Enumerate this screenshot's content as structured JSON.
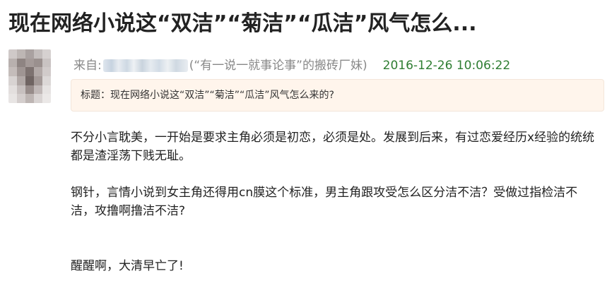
{
  "post": {
    "title": "现在网络小说这“双洁”“菊洁”“瓜洁”风气怎么...",
    "meta": {
      "from_label": "来自:",
      "author_desc": "(“有一说一就事论事”的搬砖厂妹)",
      "timestamp": "2016-12-26 10:06:22"
    },
    "subject": "标题：现在网络小说这“双洁”“菊洁”“瓜洁”风气怎么来的?",
    "body": [
      "不分小言耽美，一开始是要求主角必须是初恋，必须是处。发展到后来，有过恋爱经历x经验的统统都是渣淫荡下贱无耻。",
      "钢针，言情小说到女主角还得用cn膜这个标准，男主角跟攻受怎么区分洁不洁？受做过指检洁不洁，攻撸啊撸洁不洁?",
      "醒醒啊，大清早亡了!"
    ]
  },
  "colors": {
    "timestamp_green": "#2e7d32",
    "subject_background": "#fff5ec",
    "meta_gray": "#888888"
  }
}
